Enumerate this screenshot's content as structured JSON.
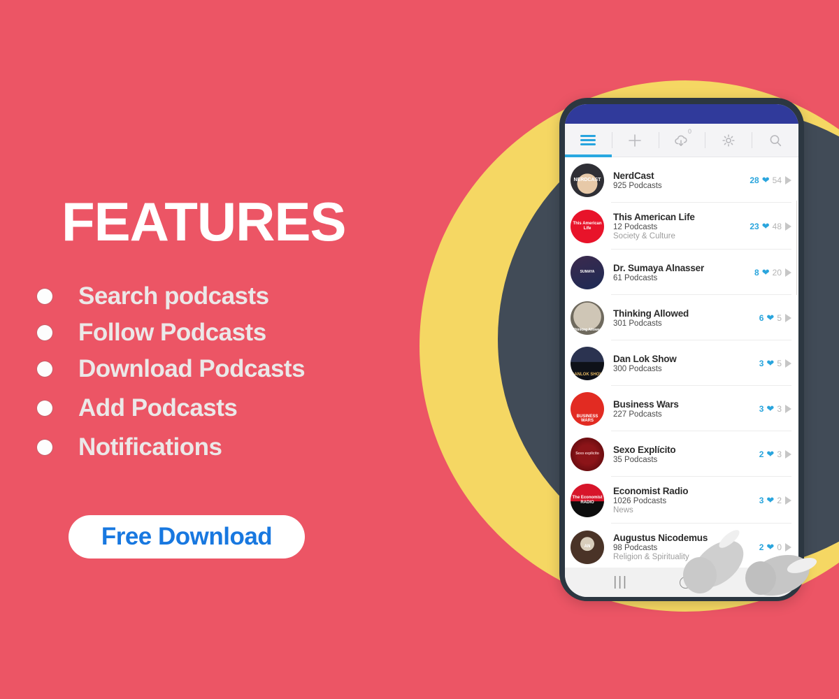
{
  "theme": {
    "background": "#ec5565",
    "circle_yellow": "#f5d763",
    "circle_dark": "#414b57",
    "accent_blue": "#2aa5dd",
    "cta_text_color": "#1878e0",
    "status_bar": "#303a9b"
  },
  "promo": {
    "title": "FEATURES",
    "features": [
      {
        "label": "Search podcasts"
      },
      {
        "label": "Follow Podcasts"
      },
      {
        "label": "Download Podcasts"
      },
      {
        "label": "Add Podcasts"
      },
      {
        "label": "Notifications"
      }
    ],
    "cta_label": "Free Download"
  },
  "phone": {
    "toolbar": {
      "items": [
        {
          "icon": "hamburger-menu-icon",
          "label": "Menu",
          "active": true
        },
        {
          "icon": "plus-icon",
          "label": "Add",
          "active": false
        },
        {
          "icon": "cloud-download-icon",
          "label": "Downloads",
          "badge": "0",
          "active": false
        },
        {
          "icon": "gear-icon",
          "label": "Settings",
          "active": false
        },
        {
          "icon": "search-icon",
          "label": "Search",
          "active": false
        }
      ]
    },
    "podcasts": [
      {
        "title": "NerdCast",
        "episodes": "925 Podcasts",
        "category": "",
        "likes": "28",
        "plays": "54",
        "art_text": "NERDCAST",
        "art_color": "#2f2f35"
      },
      {
        "title": "This American Life",
        "episodes": "12 Podcasts",
        "category": "Society & Culture",
        "likes": "23",
        "plays": "48",
        "art_text": "This American Life",
        "art_color": "#e8132a"
      },
      {
        "title": "Dr. Sumaya Alnasser",
        "episodes": "61 Podcasts",
        "category": "",
        "likes": "8",
        "plays": "20",
        "art_text": "SUMAYA",
        "art_color": "#1d2a55"
      },
      {
        "title": "Thinking Allowed",
        "episodes": "301 Podcasts",
        "category": "",
        "likes": "6",
        "plays": "5",
        "art_text": "Thinking Allowed",
        "art_color": "#7d786d"
      },
      {
        "title": "Dan Lok Show",
        "episodes": "300 Podcasts",
        "category": "",
        "likes": "3",
        "plays": "5",
        "art_text": "DANLOK SHOW",
        "art_color": "#1b1f2b"
      },
      {
        "title": "Business Wars",
        "episodes": "227 Podcasts",
        "category": "",
        "likes": "3",
        "plays": "3",
        "art_text": "BUSINESS WARS",
        "art_color": "#e22b22"
      },
      {
        "title": "Sexo Explícito",
        "episodes": "35 Podcasts",
        "category": "",
        "likes": "2",
        "plays": "3",
        "art_text": "Sexo explicito",
        "art_color": "#7d0f12"
      },
      {
        "title": "Economist Radio",
        "episodes": "1026 Podcasts",
        "category": "News",
        "likes": "3",
        "plays": "2",
        "art_text": "The Economist RADIO",
        "art_color": "#d7152a"
      },
      {
        "title": "Augustus Nicodemus",
        "episodes": "98 Podcasts",
        "category": "Religion & Spirituality",
        "likes": "2",
        "plays": "0",
        "art_text": "AN",
        "art_color": "#4a3327"
      }
    ],
    "navbar": {
      "recents_label": "|||",
      "home_label": "home-circle",
      "back_label": "back-triangle"
    }
  }
}
